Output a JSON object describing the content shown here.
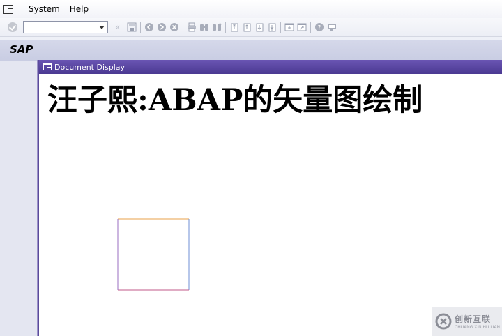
{
  "menubar": {
    "items": [
      {
        "label": "System",
        "underline": "S"
      },
      {
        "label": "Help",
        "underline": "H"
      }
    ]
  },
  "toolbar": {
    "command_field": {
      "value": "",
      "placeholder": ""
    },
    "icons": [
      "enter-icon",
      "save-icon",
      "back-icon",
      "exit-icon",
      "cancel-icon",
      "print-icon",
      "find-icon",
      "find-next-icon",
      "first-page-icon",
      "previous-page-icon",
      "next-page-icon",
      "last-page-icon",
      "create-session-icon",
      "generate-shortcut-icon",
      "help-icon",
      "customize-layout-icon"
    ]
  },
  "header": {
    "logo": "SAP"
  },
  "dialog": {
    "title": "Document Display",
    "heading": "汪子熙:ABAP的矢量图绘制",
    "rectangle": {
      "stroke_colors": [
        "#e8a04a",
        "#6f8fd6",
        "#c05a8a",
        "#9a6cc0"
      ]
    }
  },
  "watermark": {
    "text_cn": "创新互联",
    "text_en": "CHUANG XIN HU LIAN"
  },
  "colors": {
    "dialog_title_bg": "#5643a3",
    "sap_bar_bg": "#cfd2e6"
  }
}
